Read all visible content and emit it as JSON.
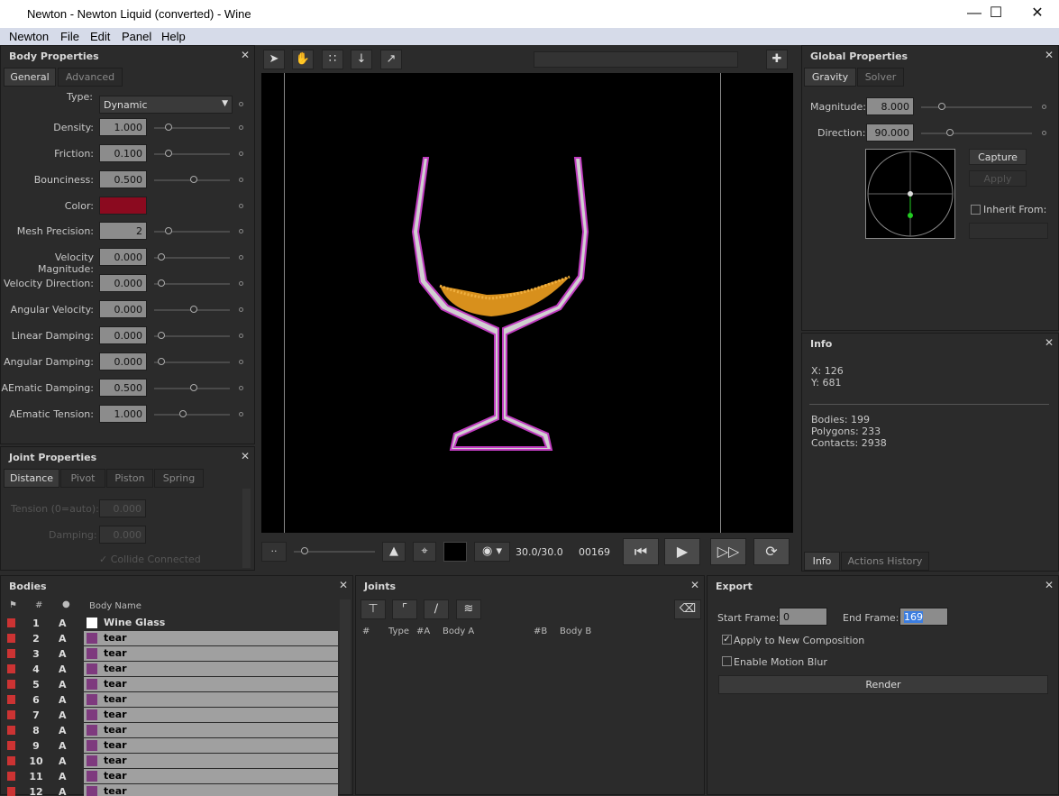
{
  "window": {
    "title": "Newton - Newton Liquid (converted) - Wine"
  },
  "menu": [
    "Newton",
    "File",
    "Edit",
    "Panel",
    "Help"
  ],
  "body_props": {
    "title": "Body Properties",
    "tabs": [
      "General",
      "Advanced"
    ],
    "type_label": "Type:",
    "type_value": "Dynamic",
    "rows": [
      {
        "label": "Density:",
        "value": "1.000",
        "level": 0.15
      },
      {
        "label": "Friction:",
        "value": "0.100",
        "level": 0.15
      },
      {
        "label": "Bounciness:",
        "value": "0.500",
        "level": 0.5
      },
      {
        "label": "Color:",
        "value": ""
      },
      {
        "label": "Mesh Precision:",
        "value": "2",
        "level": 0.15
      },
      {
        "label": "Velocity Magnitude:",
        "value": "0.000",
        "level": 0.05
      },
      {
        "label": "Velocity Direction:",
        "value": "0.000",
        "level": 0.05
      },
      {
        "label": "Angular Velocity:",
        "value": "0.000",
        "level": 0.5
      },
      {
        "label": "Linear Damping:",
        "value": "0.000",
        "level": 0.05
      },
      {
        "label": "Angular Damping:",
        "value": "0.000",
        "level": 0.05
      },
      {
        "label": "AEmatic Damping:",
        "value": "0.500",
        "level": 0.5
      },
      {
        "label": "AEmatic Tension:",
        "value": "1.000",
        "level": 0.35
      }
    ],
    "color": "#8b0a1f"
  },
  "joint_props": {
    "title": "Joint Properties",
    "tabs": [
      "Distance",
      "Pivot",
      "Piston",
      "Spring"
    ],
    "tension_label": "Tension (0=auto):",
    "tension_value": "0.000",
    "damping_label": "Damping:",
    "damping_value": "0.000",
    "collide_label": "Collide Connected"
  },
  "viewport": {
    "fps": "30.0/30.0",
    "frame": "00169"
  },
  "global_props": {
    "title": "Global Properties",
    "tabs": [
      "Gravity",
      "Solver"
    ],
    "magnitude_label": "Magnitude:",
    "magnitude_value": "8.000",
    "direction_label": "Direction:",
    "direction_value": "90.000",
    "capture": "Capture",
    "apply": "Apply",
    "inherit": "Inherit From:"
  },
  "info": {
    "title": "Info",
    "x": "X: 126",
    "y": "Y: 681",
    "bodies": "Bodies: 199",
    "polygons": "Polygons: 233",
    "contacts": "Contacts: 2938",
    "tabs": [
      "Info",
      "Actions History"
    ]
  },
  "bodies": {
    "title": "Bodies",
    "headers": {
      "num": "#",
      "name": "Body Name"
    },
    "rows": [
      {
        "num": "1",
        "a": "A",
        "name": "Wine Glass",
        "first": true
      },
      {
        "num": "2",
        "a": "A",
        "name": "tear"
      },
      {
        "num": "3",
        "a": "A",
        "name": "tear"
      },
      {
        "num": "4",
        "a": "A",
        "name": "tear"
      },
      {
        "num": "5",
        "a": "A",
        "name": "tear"
      },
      {
        "num": "6",
        "a": "A",
        "name": "tear"
      },
      {
        "num": "7",
        "a": "A",
        "name": "tear"
      },
      {
        "num": "8",
        "a": "A",
        "name": "tear"
      },
      {
        "num": "9",
        "a": "A",
        "name": "tear"
      },
      {
        "num": "10",
        "a": "A",
        "name": "tear"
      },
      {
        "num": "11",
        "a": "A",
        "name": "tear"
      },
      {
        "num": "12",
        "a": "A",
        "name": "tear"
      }
    ]
  },
  "joints": {
    "title": "Joints",
    "headers": [
      "#",
      "Type",
      "#A",
      "Body A",
      "#B",
      "Body B"
    ]
  },
  "export": {
    "title": "Export",
    "start_label": "Start Frame:",
    "start_value": "0",
    "end_label": "End Frame:",
    "end_value": "169",
    "apply_label": "Apply to New Composition",
    "blur_label": "Enable Motion Blur",
    "render": "Render"
  }
}
